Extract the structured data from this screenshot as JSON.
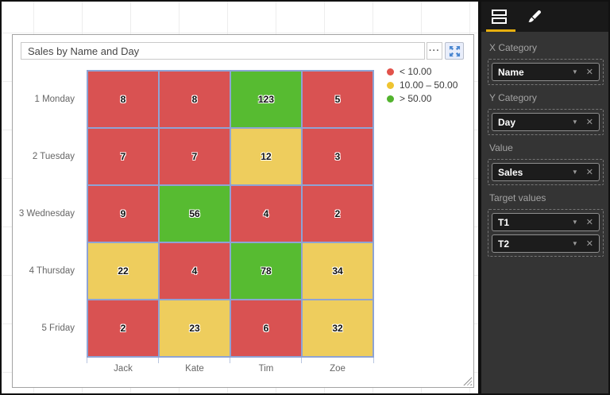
{
  "visual": {
    "title": "Sales by Name and Day"
  },
  "icons": {
    "more_options": "···",
    "caret": "▼",
    "remove": "✕"
  },
  "chart_data": {
    "type": "heatmap",
    "title": "Sales by Name and Day",
    "x_categories": [
      "Jack",
      "Kate",
      "Tim",
      "Zoe"
    ],
    "y_categories": [
      "1 Monday",
      "2 Tuesday",
      "3 Wednesday",
      "4 Thursday",
      "5 Friday"
    ],
    "values": [
      [
        8,
        8,
        123,
        5
      ],
      [
        7,
        7,
        12,
        3
      ],
      [
        9,
        56,
        4,
        2
      ],
      [
        22,
        4,
        78,
        34
      ],
      [
        2,
        23,
        6,
        32
      ]
    ],
    "thresholds": {
      "low_below": 10,
      "high_above": 50
    },
    "colors": {
      "low": "#d95252",
      "mid": "#eecd5d",
      "high": "#57bb31",
      "cell_border": "#8ea3d4"
    },
    "legend": [
      {
        "color": "#e2524a",
        "label": "< 10.00"
      },
      {
        "color": "#efc431",
        "label": "10.00 – 50.00"
      },
      {
        "color": "#52b32e",
        "label": "> 50.00"
      }
    ],
    "legend_position": "top-right",
    "grid": true
  },
  "sidebar": {
    "accent": "#e7af0f",
    "tabs": [
      {
        "name": "fields",
        "active": true
      },
      {
        "name": "format",
        "active": false
      }
    ],
    "sections": [
      {
        "label": "X Category",
        "fields": [
          "Name"
        ]
      },
      {
        "label": "Y Category",
        "fields": [
          "Day"
        ]
      },
      {
        "label": "Value",
        "fields": [
          "Sales"
        ]
      },
      {
        "label": "Target values",
        "fields": [
          "T1",
          "T2"
        ]
      }
    ]
  }
}
